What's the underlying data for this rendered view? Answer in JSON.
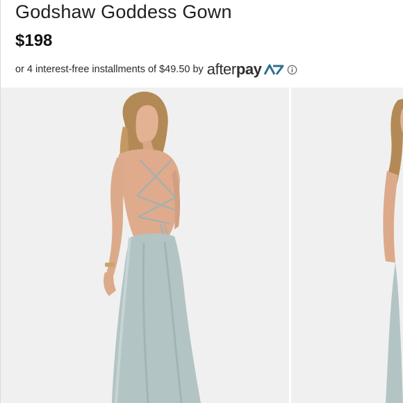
{
  "product": {
    "title": "Godshaw Goddess Gown",
    "price": "$198"
  },
  "payment": {
    "prefix": "or 4 interest-free installments of",
    "installment_amount": "$49.50",
    "by": "by",
    "provider_part1": "after",
    "provider_part2": "pay",
    "info_icon": "info-circle-icon"
  },
  "gallery": {
    "images": [
      {
        "name": "product-photo-back-view"
      },
      {
        "name": "product-photo-side-view"
      }
    ]
  },
  "colors": {
    "dress": "#b3c4c4",
    "background": "#f0f0f0",
    "afterpay_accent": "#2f6f8f"
  }
}
